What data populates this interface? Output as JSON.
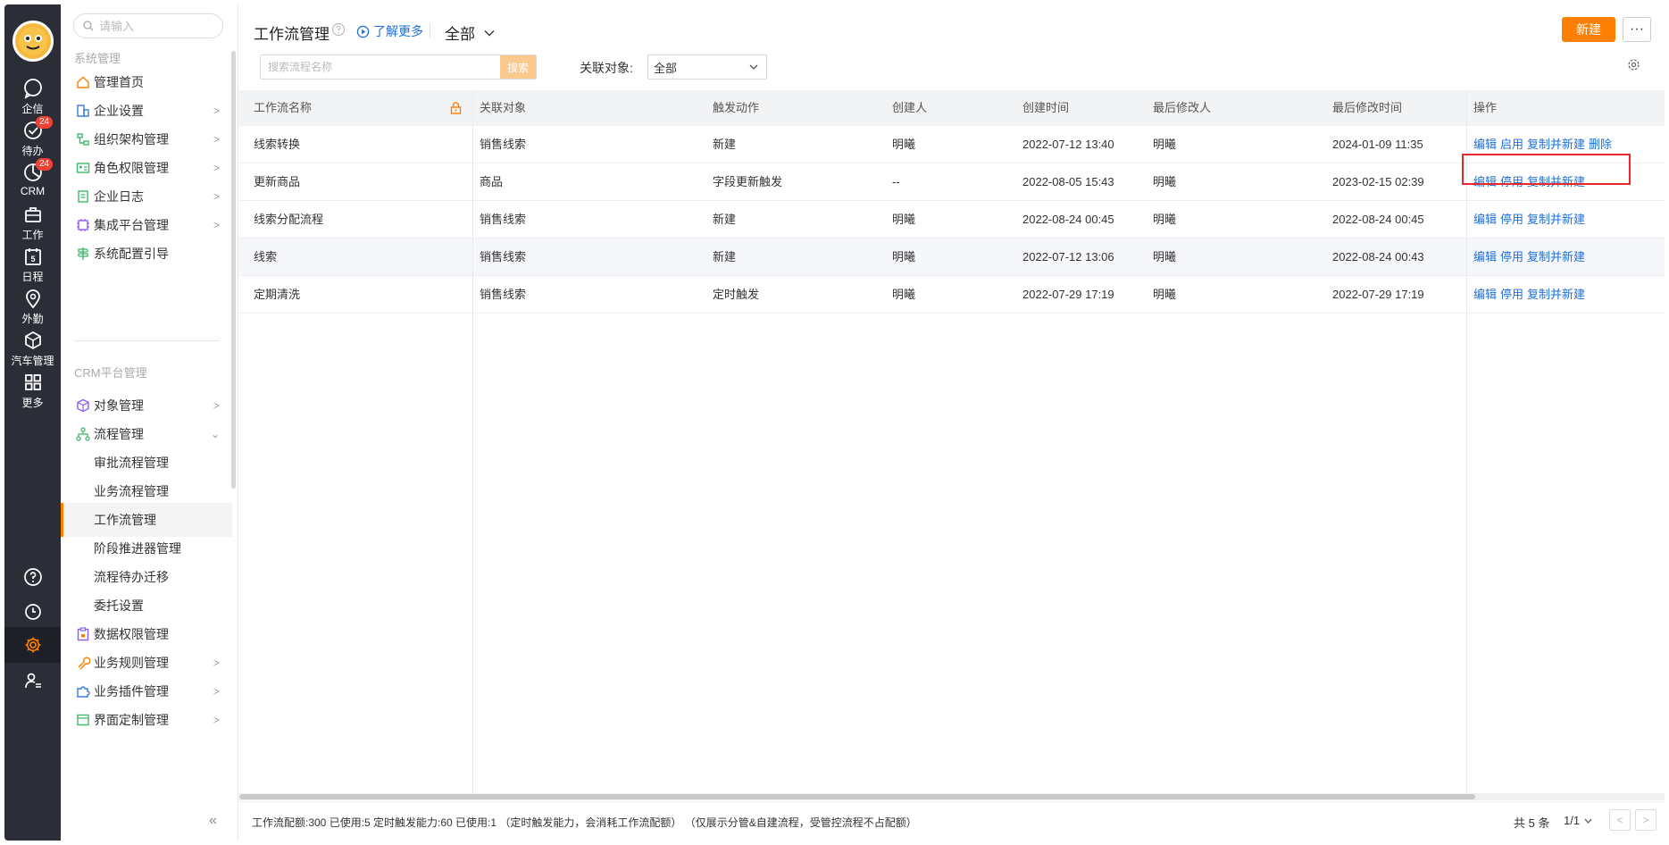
{
  "rail": {
    "items": [
      {
        "label": "企信",
        "icon": "chat-bubble-icon"
      },
      {
        "label": "待办",
        "icon": "check-circle-icon",
        "badge": "24"
      },
      {
        "label": "CRM",
        "icon": "pie-chart-icon",
        "badge": "24"
      },
      {
        "label": "工作",
        "icon": "briefcase-icon"
      },
      {
        "label": "日程",
        "icon": "calendar-icon",
        "day": "5"
      },
      {
        "label": "外勤",
        "icon": "location-pin-icon"
      },
      {
        "label": "汽车管理",
        "icon": "cube-icon"
      },
      {
        "label": "更多",
        "icon": "grid-icon"
      }
    ]
  },
  "menu": {
    "search_placeholder": "请输入",
    "section1": "系统管理",
    "section2": "CRM平台管理",
    "items": [
      {
        "label": "管理首页"
      },
      {
        "label": "企业设置"
      },
      {
        "label": "组织架构管理"
      },
      {
        "label": "角色权限管理"
      },
      {
        "label": "企业日志"
      },
      {
        "label": "集成平台管理"
      },
      {
        "label": "系统配置引导"
      },
      {
        "label": "对象管理"
      },
      {
        "label": "流程管理"
      },
      {
        "label": "审批流程管理"
      },
      {
        "label": "业务流程管理"
      },
      {
        "label": "工作流管理"
      },
      {
        "label": "阶段推进器管理"
      },
      {
        "label": "流程待办迁移"
      },
      {
        "label": "委托设置"
      },
      {
        "label": "数据权限管理"
      },
      {
        "label": "业务规则管理"
      },
      {
        "label": "业务插件管理"
      },
      {
        "label": "界面定制管理"
      }
    ],
    "collapse": "«"
  },
  "header": {
    "title": "工作流管理",
    "learn_more": "了解更多",
    "scope": "全部",
    "new_label": "新建",
    "more_label": "···"
  },
  "filters": {
    "search_placeholder": "搜索流程名称",
    "search_btn": "搜索",
    "related_label": "关联对象:",
    "related_value": "全部"
  },
  "table": {
    "columns": [
      "工作流名称",
      "关联对象",
      "触发动作",
      "创建人",
      "创建时间",
      "最后修改人",
      "最后修改时间",
      "操作"
    ],
    "rows": [
      {
        "name": "线索转换",
        "object": "销售线索",
        "action": "新建",
        "creator": "明曦",
        "created": "2022-07-12 13:40",
        "modifier": "明曦",
        "modified": "2024-01-09 11:35",
        "ops": [
          "编辑",
          "启用",
          "复制并新建",
          "删除"
        ]
      },
      {
        "name": "更新商品",
        "object": "商品",
        "action": "字段更新触发",
        "creator": "--",
        "created": "2022-08-05 15:43",
        "modifier": "明曦",
        "modified": "2023-02-15 02:39",
        "ops": [
          "编辑",
          "停用",
          "复制并新建"
        ]
      },
      {
        "name": "线索分配流程",
        "object": "销售线索",
        "action": "新建",
        "creator": "明曦",
        "created": "2022-08-24 00:45",
        "modifier": "明曦",
        "modified": "2022-08-24 00:45",
        "ops": [
          "编辑",
          "停用",
          "复制并新建"
        ]
      },
      {
        "name": "线索",
        "object": "销售线索",
        "action": "新建",
        "creator": "明曦",
        "created": "2022-07-12 13:06",
        "modifier": "明曦",
        "modified": "2022-08-24 00:43",
        "ops": [
          "编辑",
          "停用",
          "复制并新建"
        ]
      },
      {
        "name": "定期清洗",
        "object": "销售线索",
        "action": "定时触发",
        "creator": "明曦",
        "created": "2022-07-29 17:19",
        "modifier": "明曦",
        "modified": "2022-07-29 17:19",
        "ops": [
          "编辑",
          "停用",
          "复制并新建"
        ]
      }
    ]
  },
  "footer": {
    "info": "工作流配额:300  已使用:5  定时触发能力:60  已使用:1  （定时触发能力，会消耗工作流配额）  （仅展示分管&自建流程，受管控流程不占配额）",
    "total": "共 5 条",
    "page": "1/1",
    "prev": "<",
    "next": ">"
  },
  "colors": {
    "accent": "#ff8000",
    "link": "#1e6fdc",
    "rail": "#2b2e36",
    "highlight": "#e8262c"
  }
}
